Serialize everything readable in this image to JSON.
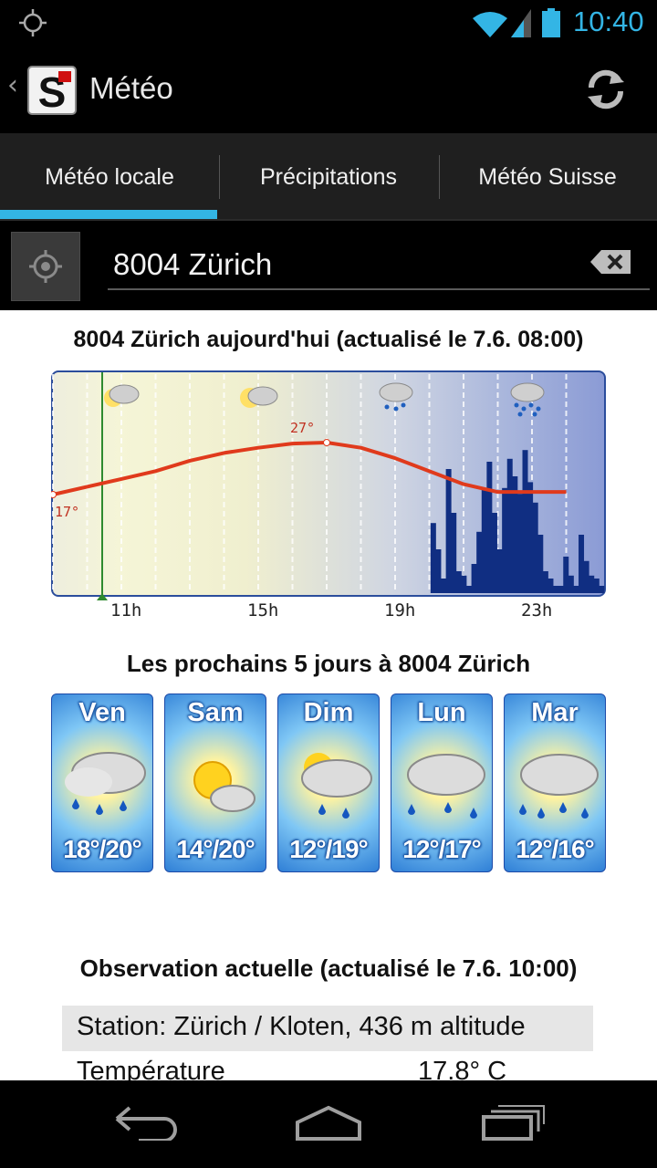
{
  "status_bar": {
    "time": "10:40",
    "icons": [
      "gps-icon",
      "wifi-icon",
      "cell-signal-icon",
      "battery-icon"
    ],
    "accent": "#33b5e5"
  },
  "action_bar": {
    "title": "Météo",
    "icons": [
      "back-chevron-icon",
      "app-logo-icon",
      "refresh-icon"
    ]
  },
  "tabs": [
    {
      "label": "Météo locale",
      "selected": true
    },
    {
      "label": "Précipitations",
      "selected": false
    },
    {
      "label": "Météo Suisse",
      "selected": false
    }
  ],
  "location": {
    "value": "8004 Zürich",
    "icons": [
      "locate-icon",
      "clear-input-icon"
    ]
  },
  "today": {
    "heading": "8004 Zürich aujourd'hui (actualisé le 7.6. 08:00)",
    "labels": {
      "min": "17°",
      "max": "27°"
    },
    "icons": [
      "partly-cloudy-icon",
      "partly-cloudy-icon",
      "cloud-light-rain-icon",
      "cloud-heavy-rain-icon"
    ]
  },
  "chart_data": {
    "type": "line",
    "x_ticks": [
      "11h",
      "15h",
      "19h",
      "23h"
    ],
    "series": [
      {
        "values": [
          {
            "x": "9h",
            "y": 17
          },
          {
            "x": "10h",
            "y": 18.5
          },
          {
            "x": "11h",
            "y": 20
          },
          {
            "x": "12h",
            "y": 21.5
          },
          {
            "x": "13h",
            "y": 23.5
          },
          {
            "x": "14h",
            "y": 25
          },
          {
            "x": "15h",
            "y": 26
          },
          {
            "x": "16h",
            "y": 26.8
          },
          {
            "x": "17h",
            "y": 27
          },
          {
            "x": "18h",
            "y": 26
          },
          {
            "x": "19h",
            "y": 24
          },
          {
            "x": "20h",
            "y": 21.5
          },
          {
            "x": "21h",
            "y": 19
          },
          {
            "x": "22h",
            "y": 17.5
          },
          {
            "x": "23h",
            "y": 17.5
          },
          {
            "x": "24h",
            "y": 17.5
          }
        ]
      }
    ],
    "annotations": [
      "17°",
      "27°"
    ],
    "current_time_marker": "11h",
    "precipitation_bars": [
      0,
      0,
      0,
      0,
      0,
      0,
      0,
      0,
      0,
      0,
      0,
      0,
      0,
      0,
      0,
      0,
      0,
      0,
      0,
      0,
      0,
      0,
      0,
      0,
      0,
      0,
      0,
      0,
      0,
      0,
      0,
      0,
      0,
      0,
      0,
      0,
      0,
      0,
      0,
      0,
      0,
      0,
      0,
      0,
      0,
      0,
      0,
      0,
      0,
      0,
      0,
      0,
      0,
      0,
      0,
      0,
      0,
      0,
      0,
      0,
      0,
      0,
      0,
      0,
      0,
      0,
      0,
      0,
      0,
      0,
      0,
      0,
      0,
      0,
      0.48,
      0.3,
      0.1,
      0.85,
      0.55,
      0.15,
      0.12,
      0.05,
      0.2,
      0.42,
      0.72,
      0.9,
      0.55,
      0.3,
      0.72,
      0.92,
      0.8,
      0.68,
      0.98,
      0.76,
      0.62,
      0.4,
      0.15,
      0.1,
      0.05,
      0.05,
      0.25,
      0.12,
      0.05,
      0.4,
      0.22,
      0.12,
      0.1,
      0.05
    ],
    "grid": true
  },
  "forecast": {
    "heading": "Les prochains 5 jours à 8004 Zürich",
    "days": [
      {
        "name": "Ven",
        "temp": "18°/20°",
        "icon": "cloud-rain-icon"
      },
      {
        "name": "Sam",
        "temp": "14°/20°",
        "icon": "sun-cloud-icon"
      },
      {
        "name": "Dim",
        "temp": "12°/19°",
        "icon": "sun-cloud-rain-icon"
      },
      {
        "name": "Lun",
        "temp": "12°/17°",
        "icon": "cloud-rain-icon"
      },
      {
        "name": "Mar",
        "temp": "12°/16°",
        "icon": "cloud-heavy-rain-icon"
      }
    ]
  },
  "observation": {
    "heading": "Observation actuelle (actualisé le 7.6. 10:00)",
    "station": "Station: Zürich / Kloten, 436 m altitude",
    "rows": [
      {
        "label": "Température",
        "value": "17.8° C"
      }
    ]
  },
  "nav_bar": {
    "icons": [
      "back-icon",
      "home-icon",
      "recent-apps-icon"
    ]
  }
}
